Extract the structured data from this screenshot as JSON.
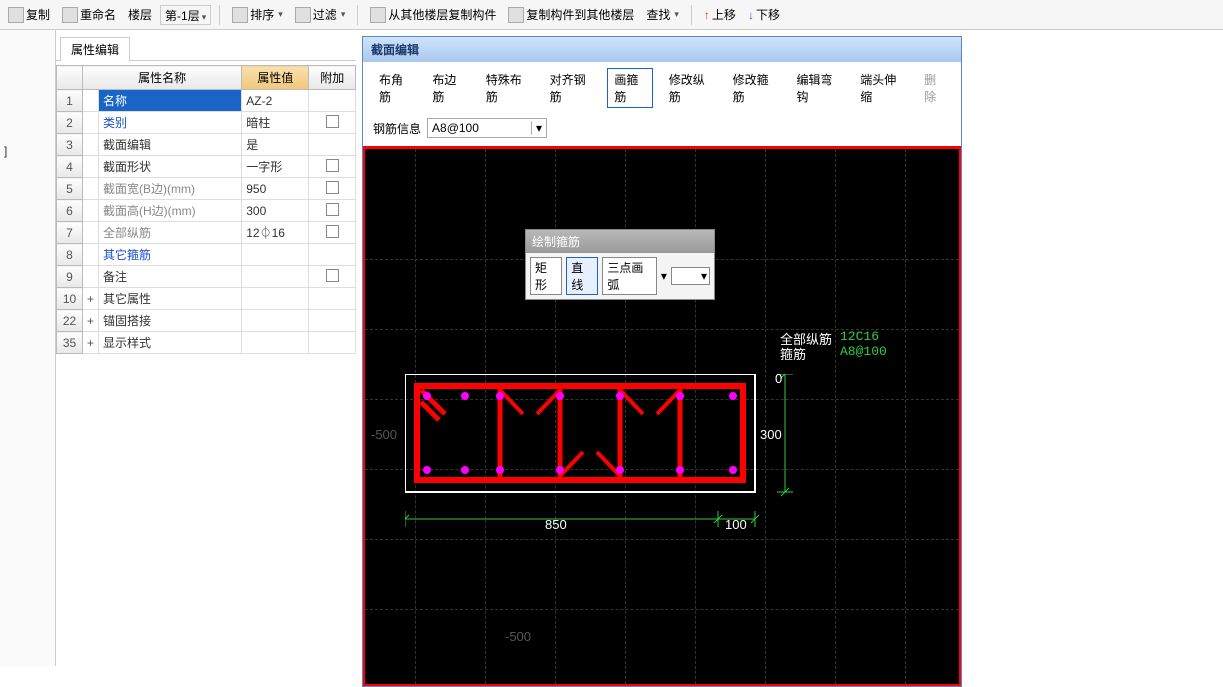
{
  "toolbar": {
    "copy": "复制",
    "rename": "重命名",
    "floor_label": "楼层",
    "floor_value": "第-1层",
    "sort": "排序",
    "filter": "过滤",
    "copy_from": "从其他楼层复制构件",
    "copy_to": "复制构件到其他楼层",
    "find": "查找",
    "move_up": "上移",
    "move_down": "下移"
  },
  "left_stub": "]",
  "prop_tab": "属性编辑",
  "prop_headers": {
    "name": "属性名称",
    "value": "属性值",
    "extra": "附加"
  },
  "rows": [
    {
      "num": "1",
      "name": "名称",
      "val": "AZ-2",
      "cls": "blue",
      "sel": true
    },
    {
      "num": "2",
      "name": "类别",
      "val": "暗柱",
      "cls": "blue",
      "chk": true
    },
    {
      "num": "3",
      "name": "截面编辑",
      "val": "是",
      "cls": ""
    },
    {
      "num": "4",
      "name": "截面形状",
      "val": "一字形",
      "cls": "",
      "chk": true
    },
    {
      "num": "5",
      "name": "截面宽(B边)(mm)",
      "val": "950",
      "cls": "gray",
      "chk": true
    },
    {
      "num": "6",
      "name": "截面高(H边)(mm)",
      "val": "300",
      "cls": "gray",
      "chk": true
    },
    {
      "num": "7",
      "name": "全部纵筋",
      "val": "12⏀16",
      "cls": "gray",
      "chk": true
    },
    {
      "num": "8",
      "name": "其它箍筋",
      "val": "",
      "cls": "blue"
    },
    {
      "num": "9",
      "name": "备注",
      "val": "",
      "cls": "",
      "chk": true
    },
    {
      "num": "10",
      "exp": "+",
      "name": "其它属性",
      "val": "",
      "cls": ""
    },
    {
      "num": "22",
      "exp": "+",
      "name": "锚固搭接",
      "val": "",
      "cls": ""
    },
    {
      "num": "35",
      "exp": "+",
      "name": "显示样式",
      "val": "",
      "cls": ""
    }
  ],
  "editor": {
    "title": "截面编辑",
    "tabs": {
      "t1": "布角筋",
      "t2": "布边筋",
      "t3": "特殊布筋",
      "t4": "对齐钢筋",
      "t5": "画箍筋",
      "t6": "修改纵筋",
      "t7": "修改箍筋",
      "t8": "编辑弯钩",
      "t9": "端头伸缩",
      "t10": "删除"
    },
    "rebar_label": "钢筋信息",
    "rebar_value": "A8@100"
  },
  "float": {
    "title": "绘制箍筋",
    "rect": "矩形",
    "line": "直线",
    "arc": "三点画弧"
  },
  "canvas": {
    "label_all": "全部纵筋",
    "label_gu": "箍筋",
    "val_all": "12C16",
    "val_gu": "A8@100",
    "dim_850": "850",
    "dim_100": "100",
    "dim_300": "300",
    "dim_0": "0",
    "axis_neg500a": "-500",
    "axis_neg500b": "-500"
  }
}
